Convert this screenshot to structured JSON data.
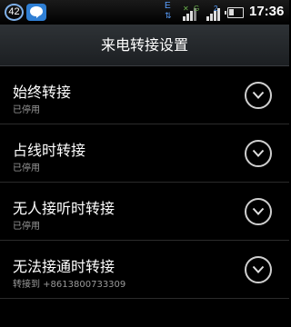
{
  "status_bar": {
    "notification_count": "42",
    "net_label": "E",
    "sim2_label": "2",
    "sim1_label": "G",
    "time": "17:36",
    "icons": [
      "notification-count-badge",
      "chat-icon",
      "network-type-icon",
      "signal-strength-icon",
      "battery-icon"
    ]
  },
  "header": {
    "title": "来电转接设置"
  },
  "items": [
    {
      "label": "始终转接",
      "sub": "已停用"
    },
    {
      "label": "占线时转接",
      "sub": "已停用"
    },
    {
      "label": "无人接听时转接",
      "sub": "已停用"
    },
    {
      "label": "无法接通时转接",
      "sub": "转接到 +8613800733309"
    }
  ]
}
